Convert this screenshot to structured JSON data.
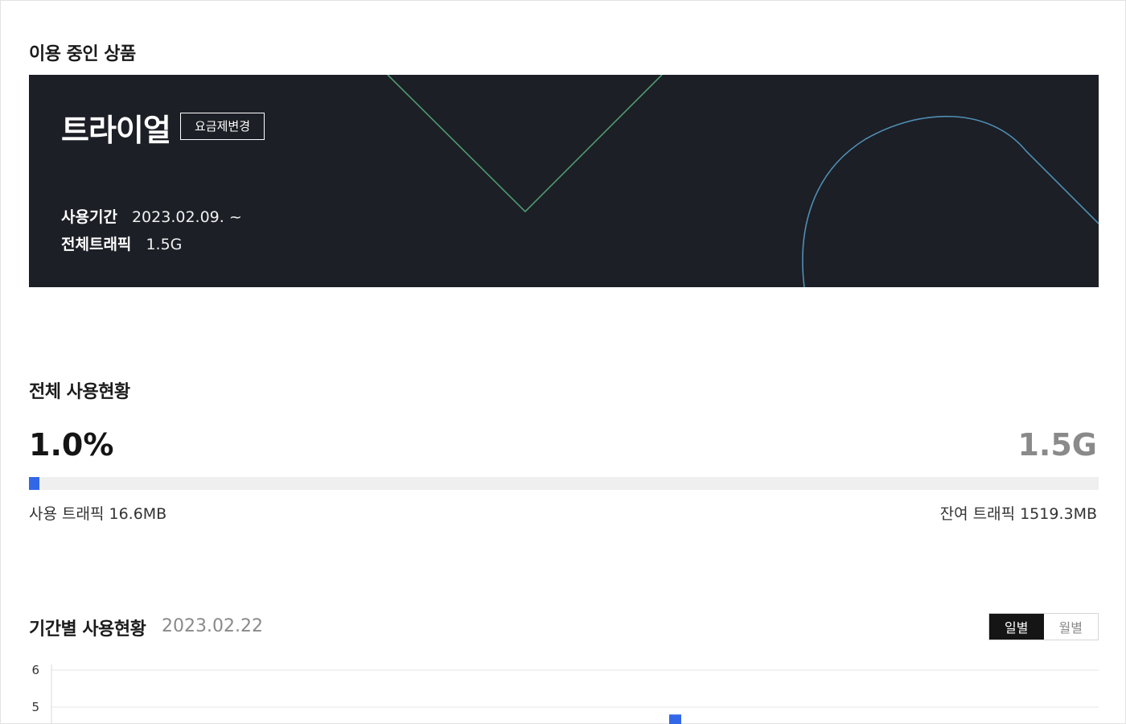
{
  "current_plan": {
    "section_title": "이용 중인 상품",
    "plan_name": "트라이얼",
    "change_button": "요금제변경",
    "period_label": "사용기간",
    "period_value": "2023.02.09. ~",
    "traffic_label": "전체트래픽",
    "traffic_value": "1.5G"
  },
  "overall_usage": {
    "section_title": "전체 사용현황",
    "percent_text": "1.0%",
    "percent": 1.0,
    "total": "1.5G",
    "used_text": "사용 트래픽 16.6MB",
    "remaining_text": "잔여 트래픽 1519.3MB",
    "bar_color": "#3268e8"
  },
  "period_usage": {
    "section_title": "기간별 사용현황",
    "date": "2023.02.22",
    "toggle": {
      "daily": "일별",
      "monthly": "월별",
      "selected": "daily"
    }
  },
  "chart_data": {
    "type": "bar",
    "y_ticks_visible": [
      "6",
      "5"
    ],
    "ylim_visible": [
      5,
      6
    ],
    "bars_visible": [
      {
        "value_above": 4.8
      }
    ],
    "bar_color": "#3268e8"
  }
}
